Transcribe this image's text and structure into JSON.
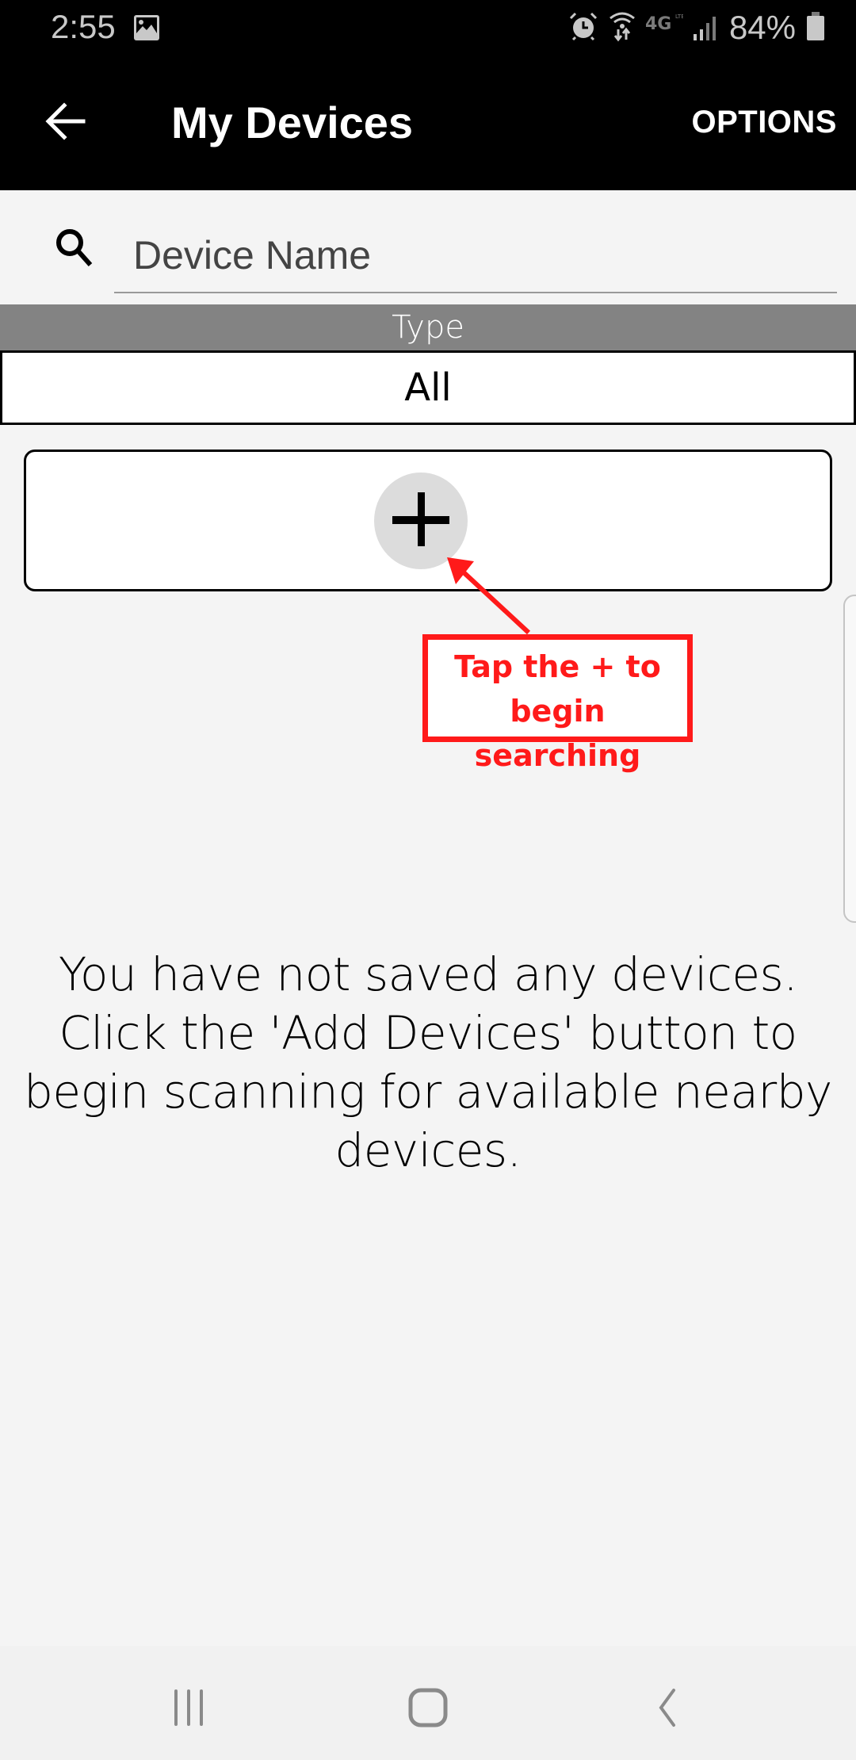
{
  "status_bar": {
    "time": "2:55",
    "battery_percent": "84%",
    "icons": [
      "gallery-icon",
      "alarm-icon",
      "wifi-data-icon",
      "4g-lte-icon",
      "signal-icon",
      "battery-icon"
    ]
  },
  "app_bar": {
    "title": "My Devices",
    "back_icon": "arrow-left-icon",
    "options_label": "OPTIONS"
  },
  "search": {
    "icon": "search-icon",
    "placeholder": "Device Name",
    "value": ""
  },
  "filter": {
    "header": "Type",
    "selected": "All"
  },
  "add_card": {
    "icon": "plus-icon"
  },
  "callout": {
    "line1": "Tap the + to",
    "line2": "begin searching",
    "color": "#ff1a1a"
  },
  "empty_state": {
    "message": "You have not saved any devices. Click the 'Add Devices' button to begin scanning for available nearby devices."
  },
  "nav_bar": {
    "recents_icon": "recents-icon",
    "home_icon": "home-icon",
    "back_icon": "back-chevron-icon"
  }
}
